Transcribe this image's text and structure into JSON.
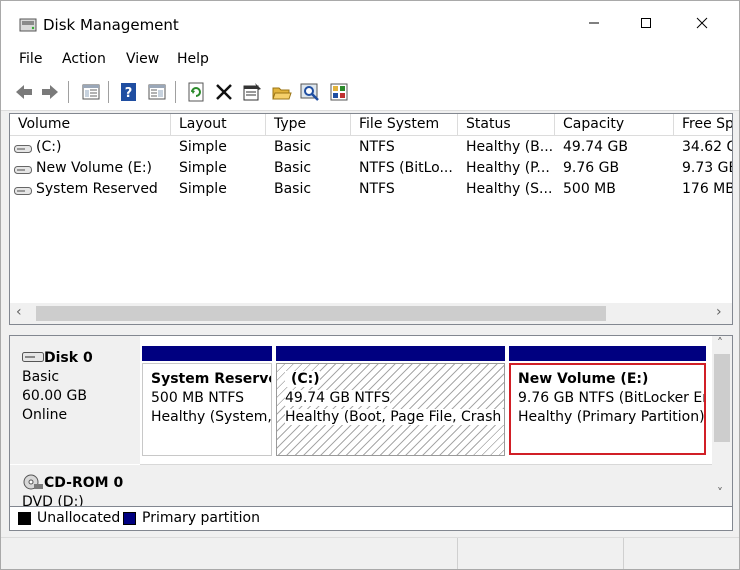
{
  "window": {
    "title": "Disk Management"
  },
  "menu": [
    "File",
    "Action",
    "View",
    "Help"
  ],
  "toolbar": [
    "back-arrow-icon",
    "forward-arrow-icon",
    "console-tree-icon",
    "help-icon",
    "details-pane-icon",
    "refresh-icon",
    "delete-icon",
    "properties-icon",
    "open-folder-icon",
    "search-disk-icon",
    "rescan-disks-icon"
  ],
  "volume_list": {
    "columns": [
      "Volume",
      "Layout",
      "Type",
      "File System",
      "Status",
      "Capacity",
      "Free Sp"
    ],
    "rows": [
      [
        "(C:)",
        "Simple",
        "Basic",
        "NTFS",
        "Healthy (B...",
        "49.74 GB",
        "34.62 G"
      ],
      [
        "New Volume (E:)",
        "Simple",
        "Basic",
        "NTFS (BitLo...",
        "Healthy (P...",
        "9.76 GB",
        "9.73 GB"
      ],
      [
        "System Reserved",
        "Simple",
        "Basic",
        "NTFS",
        "Healthy (S...",
        "500 MB",
        "176 MB"
      ]
    ]
  },
  "disks": [
    {
      "name": "Disk 0",
      "type": "Basic",
      "size": "60.00 GB",
      "status": "Online",
      "partitions": [
        {
          "title": "System Reserve",
          "line1": "500 MB NTFS",
          "line2": "Healthy (System,"
        },
        {
          "title": "(C:)",
          "line1": "49.74 GB NTFS",
          "line2": "Healthy (Boot, Page File, Crash D"
        },
        {
          "title": "New Volume  (E:)",
          "line1": "9.76 GB NTFS (BitLocker En",
          "line2": "Healthy (Primary Partition)"
        }
      ]
    },
    {
      "name": "CD-ROM 0",
      "type": "DVD (D:)"
    }
  ],
  "legend": {
    "unallocated": "Unallocated",
    "primary": "Primary partition"
  },
  "colors": {
    "primary_partition": "#000080",
    "unallocated": "#000000",
    "selection": "#d11f26"
  }
}
